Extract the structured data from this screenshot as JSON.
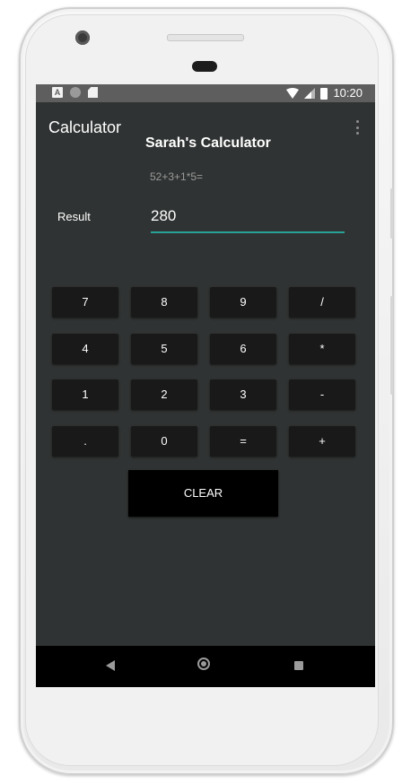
{
  "status_bar": {
    "time": "10:20"
  },
  "app_bar": {
    "title": "Calculator"
  },
  "calculator": {
    "heading": "Sarah's Calculator",
    "expression": "52+3+1*5=",
    "result_label": "Result",
    "result_value": "280"
  },
  "keypad": {
    "k7": "7",
    "k8": "8",
    "k9": "9",
    "kdiv": "/",
    "k4": "4",
    "k5": "5",
    "k6": "6",
    "kmul": "*",
    "k1": "1",
    "k2": "2",
    "k3": "3",
    "ksub": "-",
    "kdot": ".",
    "k0": "0",
    "keq": "=",
    "kadd": "+",
    "clear": "CLEAR"
  },
  "colors": {
    "screen_bg": "#303333",
    "key_bg": "#191919",
    "accent": "#2aa197"
  }
}
